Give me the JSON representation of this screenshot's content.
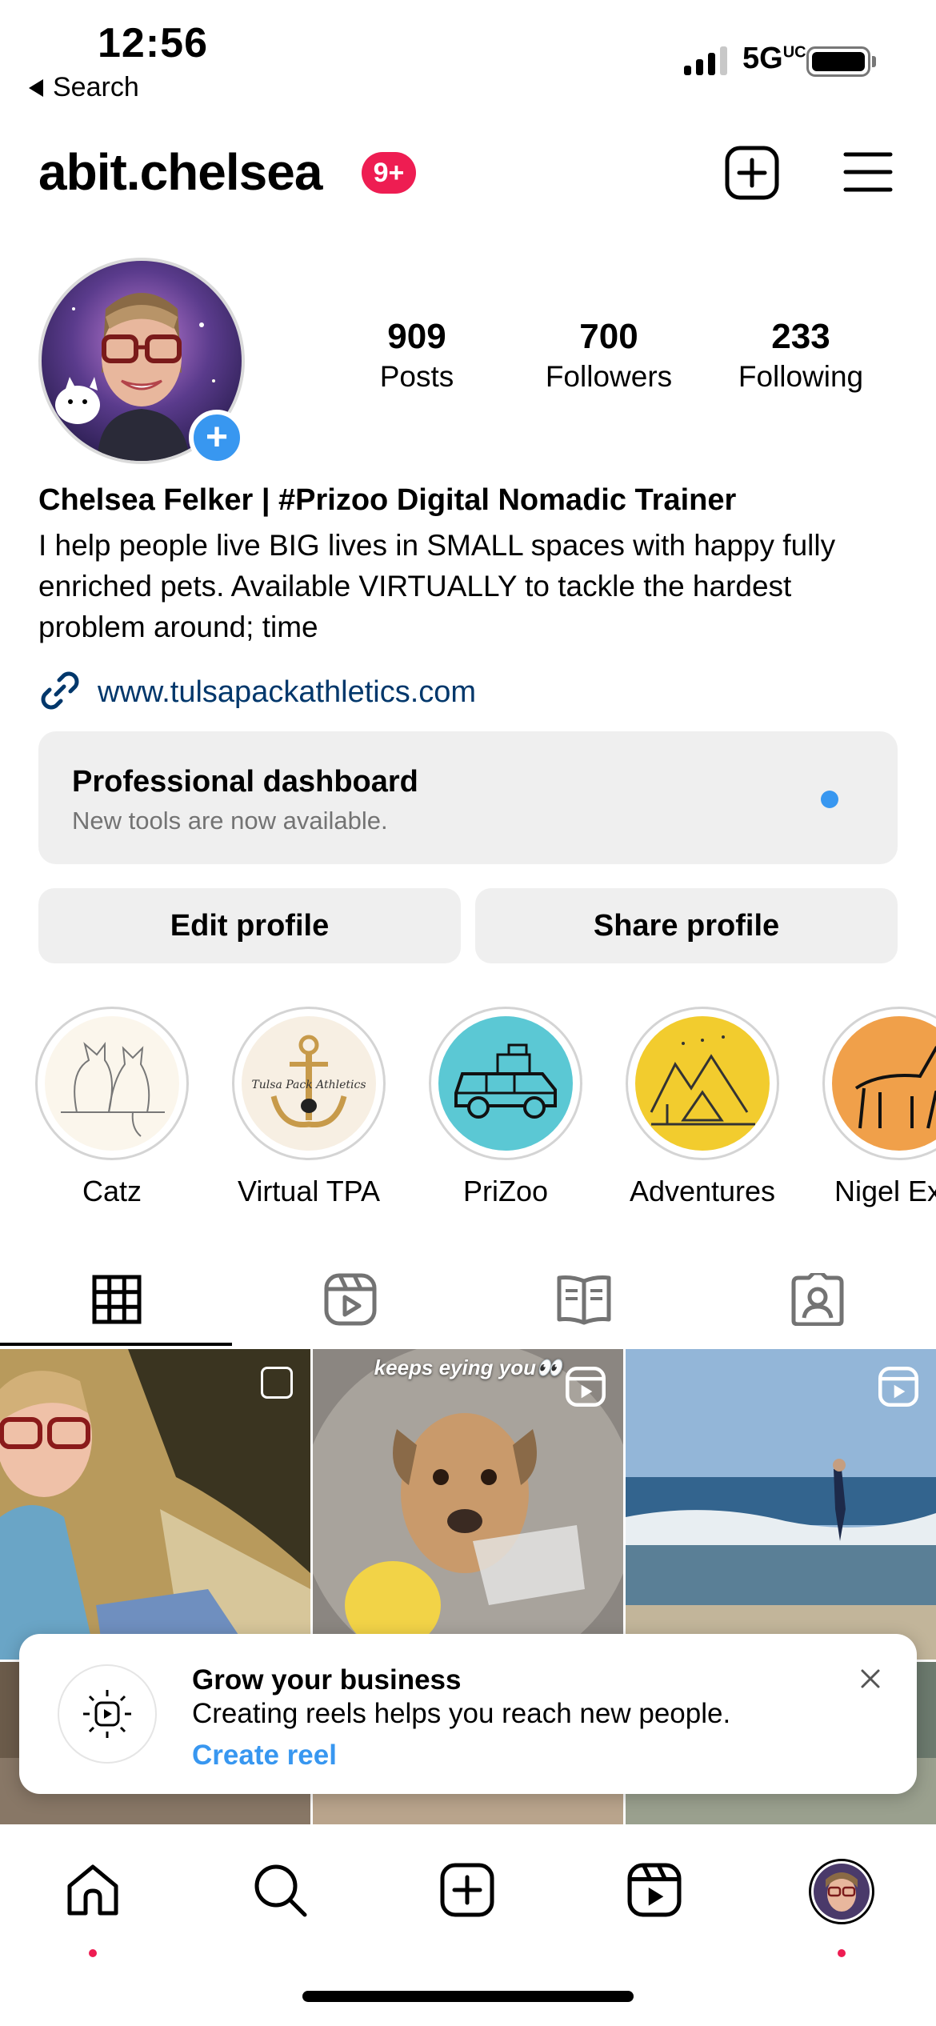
{
  "status_bar": {
    "time": "12:56",
    "back_label": "Search",
    "network": "5GUC",
    "icons": [
      "signal-icon",
      "battery-icon"
    ]
  },
  "header": {
    "username": "abit.chelsea",
    "notification_badge": "9+",
    "icons": [
      "new-post-icon",
      "menu-icon"
    ]
  },
  "profile": {
    "stats": [
      {
        "value": "909",
        "label": "Posts"
      },
      {
        "value": "700",
        "label": "Followers"
      },
      {
        "value": "233",
        "label": "Following"
      }
    ],
    "name": "Chelsea Felker | #Prizoo Digital Nomadic Trainer",
    "bio": "I help people live BIG lives in SMALL spaces with happy fully enriched pets. Available VIRTUALLY to tackle the hardest problem around; time",
    "link": "www.tulsapackathletics.com"
  },
  "dashboard": {
    "title": "Professional dashboard",
    "subtitle": "New tools are now available."
  },
  "actions": {
    "edit_label": "Edit profile",
    "share_label": "Share profile"
  },
  "highlights": [
    {
      "label": "Catz",
      "color": "#fbf6ec"
    },
    {
      "label": "Virtual TPA",
      "color": "#f7efe3"
    },
    {
      "label": "PriZoo",
      "color": "#5bc8d4"
    },
    {
      "label": "Adventures",
      "color": "#f2cc2e"
    },
    {
      "label": "Nigel Expl",
      "color": "#f0a04a"
    }
  ],
  "tabs": [
    "grid-icon",
    "reels-icon",
    "guides-icon",
    "tagged-icon"
  ],
  "grid": {
    "caption_2": "keeps eying you👀"
  },
  "toast": {
    "title": "Grow your business",
    "body": "Creating reels helps you reach new people.",
    "cta": "Create reel"
  },
  "bottom_nav": [
    "home-icon",
    "search-icon",
    "create-icon",
    "reels-icon",
    "profile-avatar"
  ],
  "colors": {
    "accent_blue": "#3897f0",
    "badge_red": "#ee1d52",
    "link_blue": "#00376b"
  }
}
